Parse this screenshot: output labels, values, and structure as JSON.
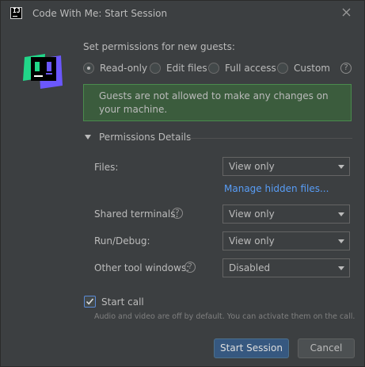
{
  "window": {
    "title": "Code With Me: Start Session",
    "app_icon_text": "IJ"
  },
  "permissions": {
    "label": "Set permissions for new guests:",
    "options": [
      {
        "label": "Read-only",
        "checked": true
      },
      {
        "label": "Edit files",
        "checked": false
      },
      {
        "label": "Full access",
        "checked": false
      },
      {
        "label": "Custom",
        "checked": false
      }
    ],
    "help": "?"
  },
  "info": {
    "text": "Guests are not allowed to make any changes on your machine."
  },
  "details": {
    "title": "Permissions Details",
    "files": {
      "label": "Files:",
      "value": "View only"
    },
    "manage_link": "Manage hidden files...",
    "terminals": {
      "label": "Shared terminals:",
      "value": "View only"
    },
    "run_debug": {
      "label": "Run/Debug:",
      "value": "View only"
    },
    "tool_windows": {
      "label": "Other tool windows:",
      "value": "Disabled"
    }
  },
  "call": {
    "label": "Start call",
    "checked": true,
    "hint": "Audio and video are off by default. You can activate them on the call."
  },
  "buttons": {
    "start": "Start Session",
    "cancel": "Cancel"
  },
  "colors": {
    "background": "#3c3f41",
    "info_box": "#3b5c3d",
    "link": "#589df6",
    "primary_button": "#365880",
    "logo_green": "#21d789",
    "logo_purple": "#6b57ff"
  }
}
